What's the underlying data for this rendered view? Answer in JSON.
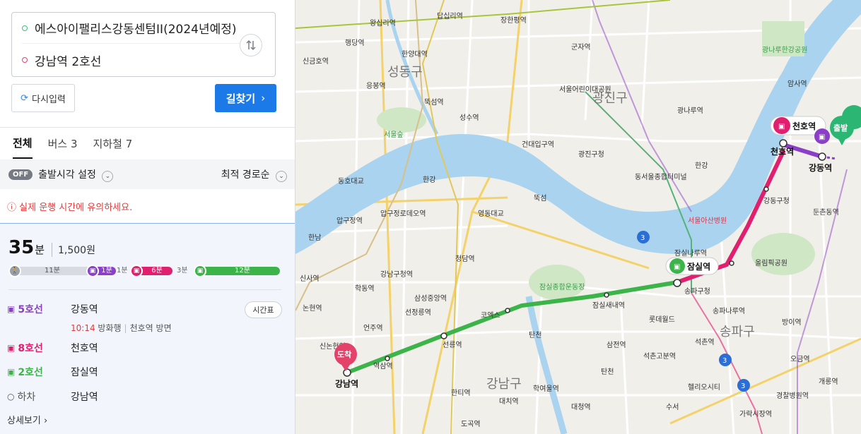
{
  "search": {
    "start": "에스아이팰리스강동센텀II(2024년예정)",
    "goal": "강남역 2호선",
    "reset_label": "다시입력",
    "go_label": "길찾기"
  },
  "tabs": [
    {
      "label": "전체"
    },
    {
      "label": "버스 3"
    },
    {
      "label": "지하철 7"
    }
  ],
  "options": {
    "departure_toggle": "OFF",
    "departure_label": "출발시각 설정",
    "sort_label": "최적 경로순"
  },
  "notice": "실제 운행 시간에 유의하세요.",
  "route": {
    "time_num": "35",
    "time_unit": "분",
    "fare": "1,500원",
    "segments": {
      "walk": "11분",
      "l5": "1분",
      "gap1": "1분",
      "l8": "6분",
      "gap2": "3분",
      "l2": "12분"
    },
    "steps": [
      {
        "line": "5호선",
        "station": "강동역"
      },
      {
        "line": "8호선",
        "station": "천호역"
      },
      {
        "line": "2호선",
        "station": "잠실역"
      },
      {
        "line": "하차",
        "station": "강남역"
      }
    ],
    "sub_time": "10:14",
    "sub_dir": "방화행",
    "sub_next": "천호역 방면",
    "timetable_label": "시간표",
    "more_label": "상세보기"
  },
  "map": {
    "districts": [
      "성동구",
      "광진구",
      "송파구",
      "강남구"
    ],
    "labels": {
      "cheonho": "천호역",
      "gangdong": "강동역",
      "jamsil": "잠실역",
      "gangnam": "강남역",
      "start_marker": "출발",
      "end_marker": "도착",
      "wangsimni": "왕십리역",
      "dapsimni": "답십리역",
      "janghanpyeong": "장한평역",
      "gunja": "군자역",
      "seongsu": "성수역",
      "kondae": "건대입구역",
      "ttukseom": "뚝섬",
      "seoulforest": "서울숲",
      "childrens": "서울어린이대공원",
      "hanyang": "한양대역",
      "haengdang": "행당역",
      "singeumho": "신금호역",
      "eungbong": "응봉역",
      "ttukseomyeok": "뚝섬역",
      "gwangjingu": "광진구청",
      "dongseoul": "동서울종합터미널",
      "gwangnaru": "광나루역",
      "gwangnaru_park": "광나루한강공원",
      "amsa": "암사역",
      "gangdongoffice": "강동구청",
      "dunchon": "둔촌동역",
      "olympic": "올림픽공원",
      "asan": "서울아산병원",
      "jamsilnaru": "잠실나루역",
      "songpa_office": "송파구청",
      "lotteworld": "롯데월드",
      "songpanaru": "송파나루역",
      "seokchon": "석촌역",
      "bangi": "방이역",
      "ogeum": "오금역",
      "gaerong": "개롱역",
      "garak": "가락시장역",
      "helio": "헬리오시티",
      "gyeongchal": "경찰병원역",
      "sincheon": "잠실새내역",
      "sports": "잠실종합운동장",
      "samseong": "삼성역",
      "coex": "코엑스",
      "seonjeongneung": "선정릉역",
      "seolleung": "선릉역",
      "yeoksam": "역삼역",
      "gangnamgucheong": "강남구청역",
      "cheongdam": "청담역",
      "apgujeongrodeo": "압구정로데오역",
      "apgujeong": "압구정역",
      "sinsa": "신사역",
      "hakdong": "학동역",
      "nonhyeon": "논현역",
      "sinnonhyeon": "신논현역",
      "eonju": "언주역",
      "hanti": "한티역",
      "daechi": "대치역",
      "hakyeoul": "학여울역",
      "daecheong": "대청역",
      "dogok": "도곡역",
      "samjeon": "삼전역",
      "seokchongobun": "석촌고분역",
      "hangang": "한강",
      "tancheon": "탄천",
      "dongho": "동호대교",
      "yeongdong": "영동대교",
      "seongsu_bridge": "성수대교",
      "hannam": "한남",
      "suseo": "수서",
      "samseongjung": "삼성중앙역",
      "jamsil_sports_label": "잠실종합운동장",
      "bongeunsa": "봉은사역"
    }
  },
  "colors": {
    "line2": "#3cb44a",
    "line5": "#8b3fc7",
    "line8": "#e0206f",
    "accent": "#1c7ae8",
    "river": "#a9d3ee"
  }
}
